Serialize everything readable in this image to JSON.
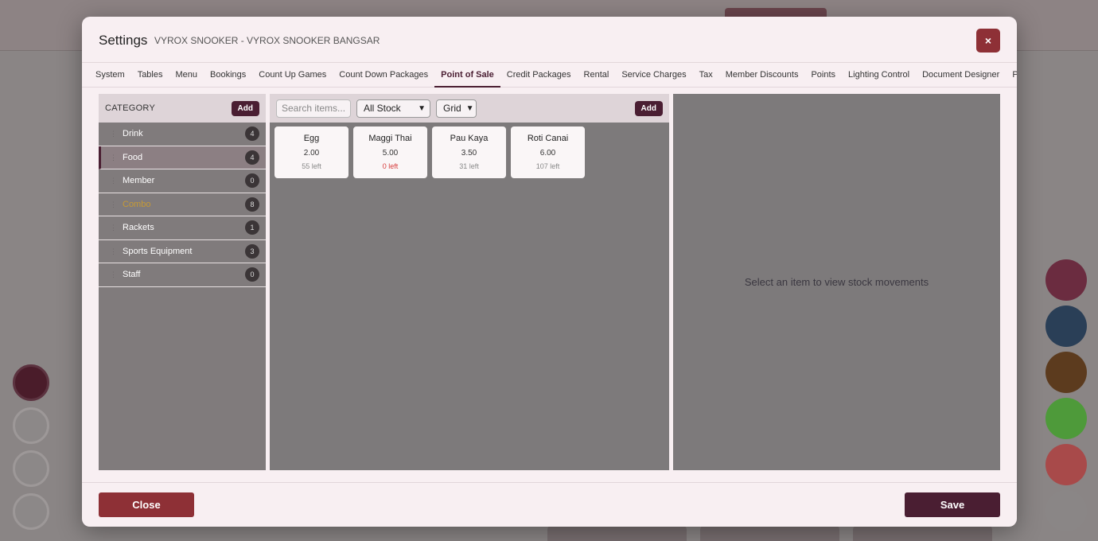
{
  "modal": {
    "title": "Settings",
    "subtitle": "VYROX SNOOKER - VYROX SNOOKER BANGSAR",
    "close_icon": "×"
  },
  "tabs": [
    {
      "label": "System"
    },
    {
      "label": "Tables"
    },
    {
      "label": "Menu"
    },
    {
      "label": "Bookings"
    },
    {
      "label": "Count Up Games"
    },
    {
      "label": "Count Down Packages"
    },
    {
      "label": "Point of Sale",
      "active": true
    },
    {
      "label": "Credit Packages"
    },
    {
      "label": "Rental"
    },
    {
      "label": "Service Charges"
    },
    {
      "label": "Tax"
    },
    {
      "label": "Member Discounts"
    },
    {
      "label": "Points"
    },
    {
      "label": "Lighting Control"
    },
    {
      "label": "Document Designer"
    },
    {
      "label": "Printers"
    }
  ],
  "category": {
    "header": "CATEGORY",
    "add_label": "Add",
    "items": [
      {
        "name": "Drink",
        "count": "4"
      },
      {
        "name": "Food",
        "count": "4",
        "selected": true
      },
      {
        "name": "Member",
        "count": "0"
      },
      {
        "name": "Combo",
        "count": "8",
        "highlight": true
      },
      {
        "name": "Rackets",
        "count": "1"
      },
      {
        "name": "Sports Equipment",
        "count": "3"
      },
      {
        "name": "Staff",
        "count": "0"
      }
    ]
  },
  "items_panel": {
    "search_placeholder": "Search items...",
    "stock_filter": "All Stock",
    "view_mode": "Grid",
    "add_label": "Add",
    "items": [
      {
        "name": "Egg",
        "price": "2.00",
        "stock": "55 left",
        "out": false
      },
      {
        "name": "Maggi Thai",
        "price": "5.00",
        "stock": "0 left",
        "out": true
      },
      {
        "name": "Pau Kaya",
        "price": "3.50",
        "stock": "31 left",
        "out": false
      },
      {
        "name": "Roti Canai",
        "price": "6.00",
        "stock": "107 left",
        "out": false
      }
    ]
  },
  "stock_panel": {
    "empty_message": "Select an item to view stock movements"
  },
  "footer": {
    "close_label": "Close",
    "save_label": "Save"
  },
  "colors": {
    "primary": "#4a1e32",
    "danger": "#8e3036",
    "warning": "#c69a35"
  }
}
